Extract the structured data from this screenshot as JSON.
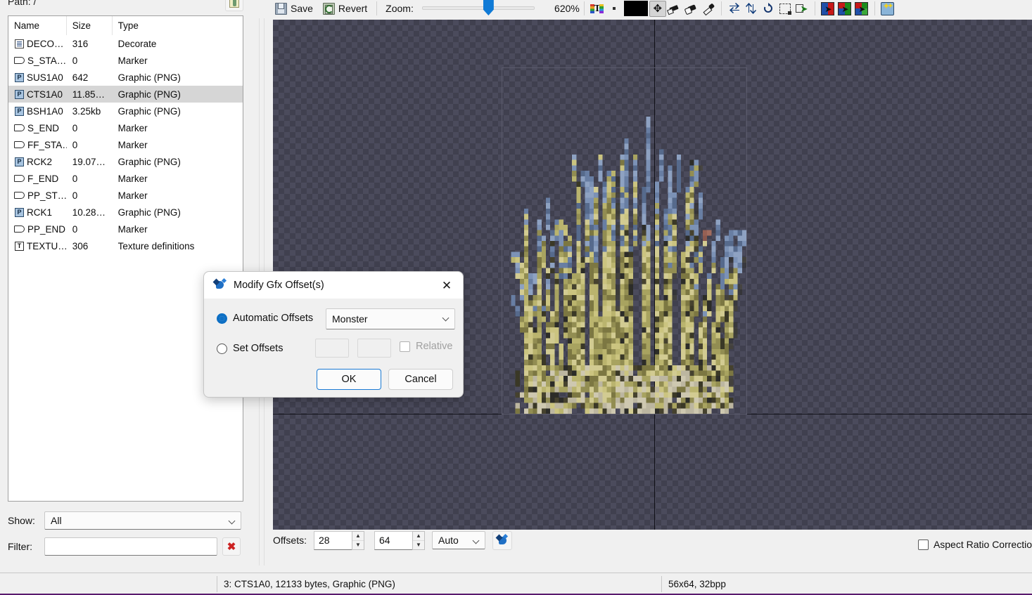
{
  "left_panel": {
    "path_label": "Path: /",
    "path_button_icon": "open-folder-icon",
    "columns": [
      "Name",
      "Size",
      "Type"
    ],
    "rows": [
      {
        "icon": "decorate-doc-icon",
        "icon_kind": "doc",
        "name": "DECO…",
        "size": "316",
        "type": "Decorate",
        "selected": false
      },
      {
        "icon": "marker-icon",
        "icon_kind": "marker",
        "name": "S_STA…",
        "size": "0",
        "type": "Marker",
        "selected": false
      },
      {
        "icon": "png-icon",
        "icon_kind": "png",
        "name": "SUS1A0",
        "size": "642",
        "type": "Graphic (PNG)",
        "selected": false
      },
      {
        "icon": "png-icon",
        "icon_kind": "png",
        "name": "CTS1A0",
        "size": "11.85…",
        "type": "Graphic (PNG)",
        "selected": true
      },
      {
        "icon": "png-icon",
        "icon_kind": "png",
        "name": "BSH1A0",
        "size": "3.25kb",
        "type": "Graphic (PNG)",
        "selected": false
      },
      {
        "icon": "marker-icon",
        "icon_kind": "marker",
        "name": "S_END",
        "size": "0",
        "type": "Marker",
        "selected": false
      },
      {
        "icon": "marker-icon",
        "icon_kind": "marker",
        "name": "FF_STA…",
        "size": "0",
        "type": "Marker",
        "selected": false
      },
      {
        "icon": "png-icon",
        "icon_kind": "png",
        "name": "RCK2",
        "size": "19.07…",
        "type": "Graphic (PNG)",
        "selected": false
      },
      {
        "icon": "marker-icon",
        "icon_kind": "marker",
        "name": "F_END",
        "size": "0",
        "type": "Marker",
        "selected": false
      },
      {
        "icon": "marker-icon",
        "icon_kind": "marker",
        "name": "PP_ST…",
        "size": "0",
        "type": "Marker",
        "selected": false
      },
      {
        "icon": "png-icon",
        "icon_kind": "png",
        "name": "RCK1",
        "size": "10.28…",
        "type": "Graphic (PNG)",
        "selected": false
      },
      {
        "icon": "marker-icon",
        "icon_kind": "marker",
        "name": "PP_END",
        "size": "0",
        "type": "Marker",
        "selected": false
      },
      {
        "icon": "texture-icon",
        "icon_kind": "tex",
        "name": "TEXTU…",
        "size": "306",
        "type": "Texture definitions",
        "selected": false
      }
    ],
    "show_label": "Show:",
    "show_value": "All",
    "filter_label": "Filter:",
    "filter_value": "",
    "filter_placeholder": "",
    "filter_clear_icon": "red-x-icon"
  },
  "toolbar": {
    "save_label": "Save",
    "save_icon": "floppy-disk-icon",
    "revert_label": "Revert",
    "revert_icon": "revert-icon",
    "zoom_label": "Zoom:",
    "zoom_percent": "620%",
    "zoom_slider_value": 620,
    "palette_icon": "palette-text-icon",
    "color_swatch": "#000000",
    "tools": [
      {
        "icon": "move-tool-icon",
        "active": true
      },
      {
        "icon": "pencil-tool-icon",
        "active": false
      },
      {
        "icon": "eraser-tool-icon",
        "active": false
      },
      {
        "icon": "dropper-tool-icon",
        "active": false
      }
    ],
    "transforms": [
      {
        "icon": "flip-horizontal-icon"
      },
      {
        "icon": "flip-vertical-icon"
      },
      {
        "icon": "rotate-icon"
      },
      {
        "icon": "crop-icon"
      },
      {
        "icon": "convert-icon"
      }
    ],
    "color_ops": [
      {
        "icon": "colourise-icon",
        "c1": "#1f4fa8",
        "c2": "#c81818",
        "c3": "#1f4fa8",
        "c4": "#c81818"
      },
      {
        "icon": "tint-icon",
        "c1": "#c81818",
        "c2": "#1b8a1b",
        "c3": "#1f4fa8",
        "c4": "#1b8a1b"
      },
      {
        "icon": "translate-icon",
        "c1": "#c81818",
        "c2": "#1b8a1b",
        "c3": "#1f4fa8",
        "c4": "#3aa83a"
      }
    ],
    "wand_icon": "magic-wand-icon"
  },
  "canvas": {
    "checker_color_a": "#4b4b5c",
    "checker_color_b": "#40404f",
    "guide_color": "#111118",
    "sprite_name": "CTS1A0",
    "sprite_width": 56,
    "sprite_height": 64
  },
  "offsets_bar": {
    "label": "Offsets:",
    "x_value": "28",
    "y_value": "64",
    "mode_value": "Auto",
    "gfx_offset_button_icon": "gfx-offsets-icon",
    "aspect_ratio_label": "Aspect Ratio Correctio",
    "aspect_ratio_checked": false
  },
  "statusbar": {
    "left": "3: CTS1A0, 12133 bytes, Graphic (PNG)",
    "right": "56x64, 32bpp",
    "accent_color": "#5a1a6e"
  },
  "dialog": {
    "title": "Modify Gfx Offset(s)",
    "title_icon": "gfx-offsets-icon",
    "close_icon": "close-icon",
    "automatic_label": "Automatic Offsets",
    "automatic_selected": true,
    "automatic_value": "Monster",
    "set_label": "Set Offsets",
    "set_selected": false,
    "set_x_value": "",
    "set_y_value": "",
    "relative_label": "Relative",
    "relative_checked": false,
    "relative_disabled": true,
    "ok_label": "OK",
    "cancel_label": "Cancel"
  }
}
